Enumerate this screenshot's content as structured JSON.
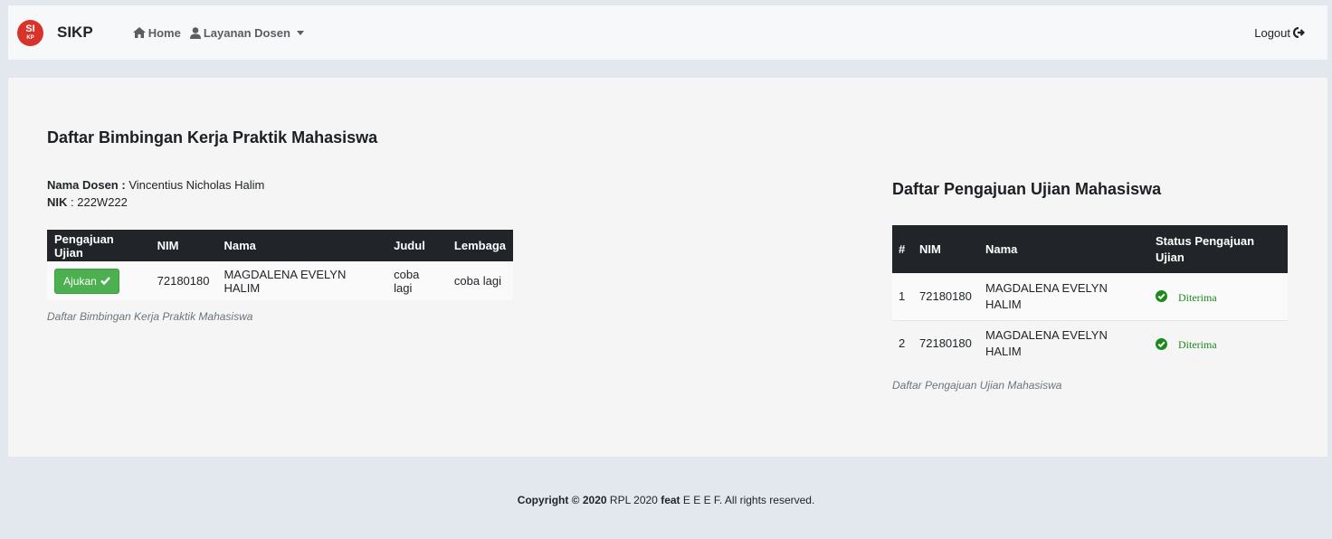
{
  "navbar": {
    "logo_top": "SI",
    "logo_bottom": "KP",
    "brand": "SIKP",
    "home": "Home",
    "layanan": "Layanan Dosen",
    "logout": "Logout"
  },
  "left": {
    "title": "Daftar Bimbingan Kerja Praktik Mahasiswa",
    "dosen_label": "Nama Dosen :",
    "dosen_value": "Vincentius Nicholas Halim",
    "nik_label": "NIK",
    "nik_value": ": 222W222",
    "table": {
      "headers": [
        "Pengajuan Ujian",
        "NIM",
        "Nama",
        "Judul",
        "Lembaga"
      ],
      "rows": [
        {
          "button": "Ajukan",
          "nim": "72180180",
          "nama": "MAGDALENA EVELYN HALIM",
          "judul": "coba lagi",
          "lembaga": "coba lagi"
        }
      ]
    },
    "caption": "Daftar Bimbingan Kerja Praktik Mahasiswa"
  },
  "right": {
    "title": "Daftar Pengajuan Ujian Mahasiswa",
    "table": {
      "headers": [
        "#",
        "NIM",
        "Nama",
        "Status Pengajuan Ujian"
      ],
      "rows": [
        {
          "no": "1",
          "nim": "72180180",
          "nama": "MAGDALENA EVELYN HALIM",
          "status": "Diterima"
        },
        {
          "no": "2",
          "nim": "72180180",
          "nama": "MAGDALENA EVELYN HALIM",
          "status": "Diterima"
        }
      ]
    },
    "caption": "Daftar Pengajuan Ujian Mahasiswa"
  },
  "footer": {
    "copyright_label": "Copyright ©",
    "year": "2020",
    "project": "RPL 2020",
    "feat": "feat",
    "team": "E E E F.",
    "rights": "All rights reserved."
  },
  "colors": {
    "logo": "#d9322b",
    "button": "#4cb050",
    "status_ok": "#1b8a1b",
    "table_header": "#212529"
  }
}
